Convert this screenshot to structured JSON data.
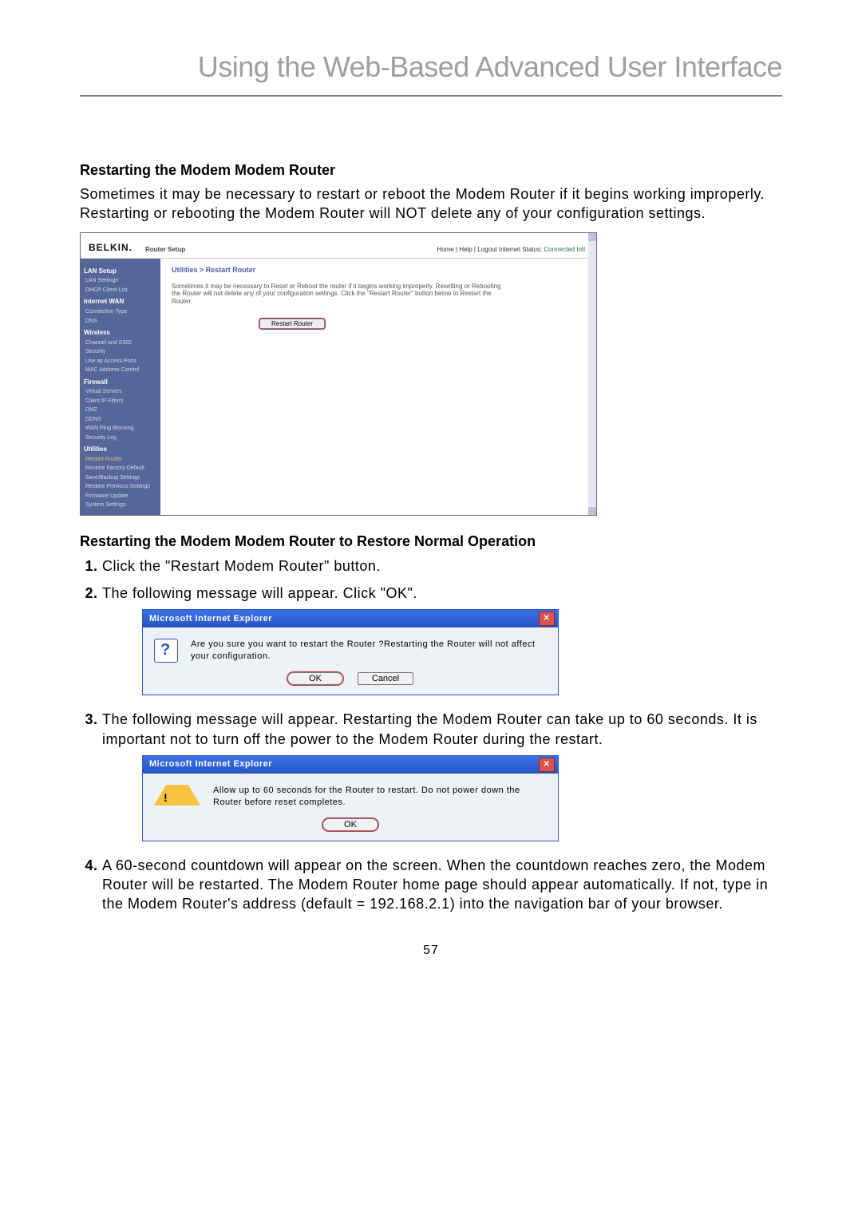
{
  "page_title": "Using the Web-Based Advanced User Interface",
  "section1_heading": "Restarting the Modem Modem Router",
  "section1_text": "Sometimes it may be necessary to restart or reboot the Modem Router if it begins working improperly. Restarting or rebooting the Modem Router will NOT delete any of your configuration settings.",
  "router": {
    "brand": "BELKIN.",
    "setup_label": "Router Setup",
    "topnav": "Home | Help | Logout   Internet Status:",
    "topnav_status": "Connected Intl",
    "crumb": "Utilities > Restart Router",
    "desc": "Sometimes it may be necessary to Reset or Reboot the router if it begins working improperly. Resetting or Rebooting the Router will not delete any of your configuration settings. Click the \"Restart Router\" button below to Restart the Router.",
    "restart_btn": "Restart Router",
    "sidebar": {
      "lan_head": "LAN Setup",
      "lan_items": [
        "LAN Settings",
        "DHCP Client List"
      ],
      "wan_head": "Internet WAN",
      "wan_items": [
        "Connection Type",
        "DNS"
      ],
      "wl_head": "Wireless",
      "wl_items": [
        "Channel and SSID",
        "Security",
        "Use as Access Point",
        "MAC Address Control"
      ],
      "fw_head": "Firewall",
      "fw_items": [
        "Virtual Servers",
        "Client IP Filters",
        "DMZ",
        "DDNS",
        "WAN Ping Blocking",
        "Security Log"
      ],
      "ut_head": "Utilities",
      "ut_items": [
        "Restart Router",
        "Restore Factory Default",
        "Save/Backup Settings",
        "Restore Previous Settings",
        "Firmware Update",
        "System Settings"
      ]
    }
  },
  "section2_heading": "Restarting the Modem Modem Router to Restore Normal Operation",
  "steps": {
    "s1": "Click the \"Restart Modem Router\" button.",
    "s2": "The following message will appear. Click \"OK\".",
    "s3": "The following message will appear. Restarting the Modem Router can take up to 60 seconds. It is important not to turn off the power to the Modem Router during the restart.",
    "s4": "A 60-second countdown will appear on the screen. When the countdown reaches zero, the Modem Router will be restarted. The Modem Router home page should appear automatically. If not, type in the Modem Router's address (default = 192.168.2.1) into the navigation bar of your browser."
  },
  "dialog1": {
    "title": "Microsoft Internet Explorer",
    "msg": "Are you sure you want to restart the Router ?Restarting the Router will not affect your configuration.",
    "ok": "OK",
    "cancel": "Cancel"
  },
  "dialog2": {
    "title": "Microsoft Internet Explorer",
    "msg": "Allow up to 60 seconds for the Router to restart. Do not power down the Router before reset completes.",
    "ok": "OK"
  },
  "page_number": "57"
}
